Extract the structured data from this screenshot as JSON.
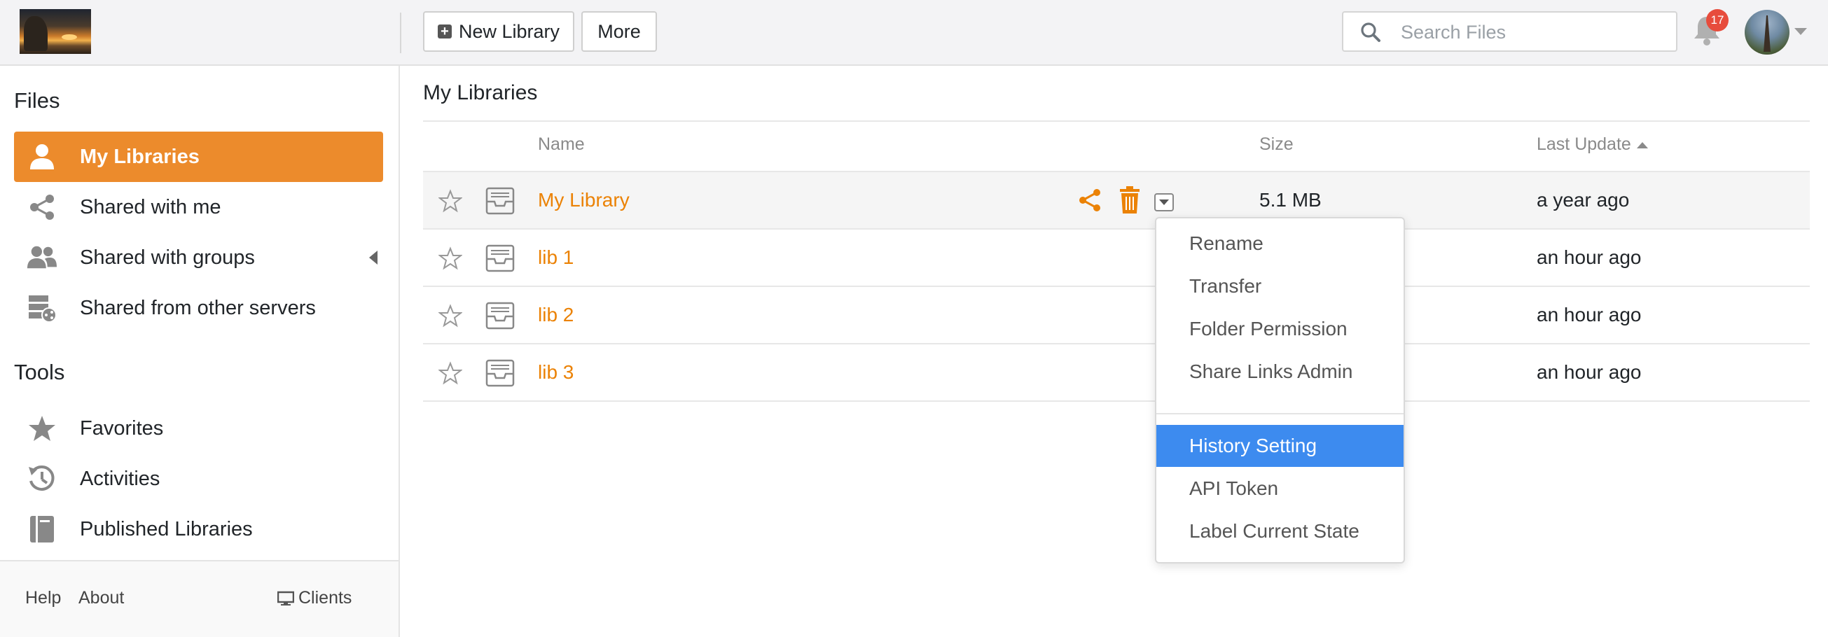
{
  "header": {
    "new_library_label": "New Library",
    "more_label": "More",
    "search_placeholder": "Search Files",
    "notification_count": "17"
  },
  "sidebar": {
    "files_heading": "Files",
    "items": [
      {
        "label": "My Libraries",
        "icon": "user-icon",
        "active": true
      },
      {
        "label": "Shared with me",
        "icon": "share-icon"
      },
      {
        "label": "Shared with groups",
        "icon": "group-icon"
      },
      {
        "label": "Shared from other servers",
        "icon": "server-share-icon"
      }
    ],
    "tools_heading": "Tools",
    "tools": [
      {
        "label": "Favorites",
        "icon": "star-icon"
      },
      {
        "label": "Activities",
        "icon": "history-icon"
      },
      {
        "label": "Published Libraries",
        "icon": "book-icon"
      }
    ],
    "footer": {
      "help": "Help",
      "about": "About",
      "clients": "Clients"
    }
  },
  "main": {
    "title": "My Libraries",
    "columns": {
      "name": "Name",
      "size": "Size",
      "last_update": "Last Update"
    },
    "rows": [
      {
        "name": "My Library",
        "size": "5.1 MB",
        "updated": "a year ago"
      },
      {
        "name": "lib 1",
        "size": "",
        "updated": "an hour ago"
      },
      {
        "name": "lib 2",
        "size": "",
        "updated": "an hour ago"
      },
      {
        "name": "lib 3",
        "size": "",
        "updated": "an hour ago"
      }
    ]
  },
  "dropdown": {
    "items": [
      "Rename",
      "Transfer",
      "Folder Permission",
      "Share Links Admin",
      "History Setting",
      "API Token",
      "Label Current State"
    ],
    "active_item": "History Setting"
  },
  "colors": {
    "accent": "#ec8b2c",
    "link": "#eb8205",
    "highlight": "#3d8bef",
    "badge": "#e74c3c"
  }
}
